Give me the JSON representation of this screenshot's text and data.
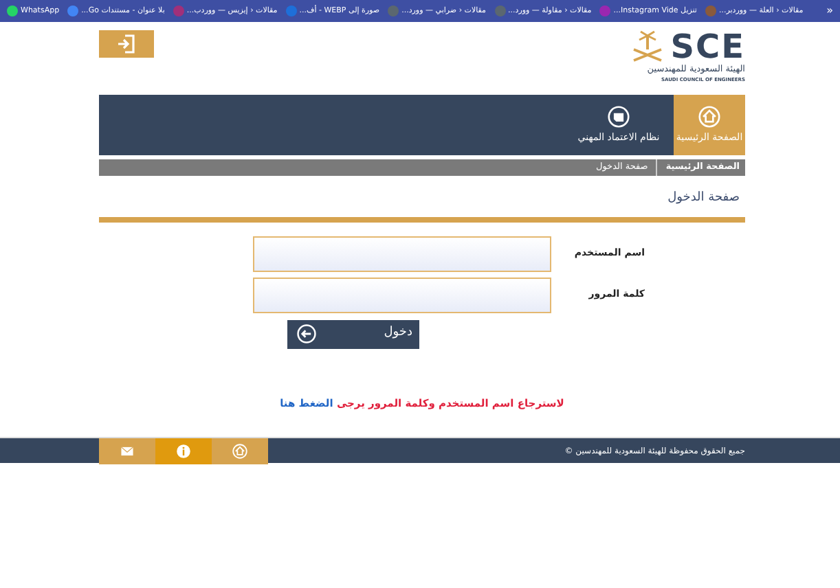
{
  "bookmarks_more": "»",
  "bookmarks": [
    {
      "label": "مقالات ‹ العلة — ووردبر...",
      "color": "#8a5a3c"
    },
    {
      "label": "تنزيل Instagram Vide...",
      "color": "#9b27b0"
    },
    {
      "label": "مقالات ‹ مقاولة — وورد...",
      "color": "#5b6770"
    },
    {
      "label": "مقالات ‹ ضرابي — وورد...",
      "color": "#5b6770"
    },
    {
      "label": "صورة إلى WEBP - أف...",
      "color": "#1e6fd9"
    },
    {
      "label": "مقالات ‹ إيزيس — ووردب...",
      "color": "#a0307a"
    },
    {
      "label": "بلا عنوان - مستندات Go...",
      "color": "#4285f4"
    },
    {
      "label": "WhatsApp",
      "color": "#25d366"
    }
  ],
  "logo": {
    "mark": "SCE",
    "name_ar": "الهيئة السعودية للمهندسين",
    "name_en": "SAUDI COUNCIL OF ENGINEERS"
  },
  "nav": [
    {
      "label": "الصفحة الرئيسية",
      "selected": true,
      "kind": "home"
    },
    {
      "label": "نظام الاعتماد المهني",
      "selected": false,
      "kind": "system"
    }
  ],
  "breadcrumb": [
    "الصفحة الرئيسية",
    "صفحة الدخول"
  ],
  "page_title": "صفحة الدخول",
  "form": {
    "fields": [
      {
        "label": "اسم المستخدم"
      },
      {
        "label": "كلمة المرور"
      }
    ],
    "submit": "دخول"
  },
  "recover": {
    "text": "لاسترجاع اسم المستخدم وكلمة المرور يرجى",
    "link": "الضغط هنا"
  },
  "footer": {
    "copyright": "جميع الحقوق محفوظة للهيئة السعودية للمهندسين ©",
    "buttons": [
      {
        "kind": "home",
        "selected": false
      },
      {
        "kind": "info",
        "selected": true
      },
      {
        "kind": "mail",
        "selected": false
      }
    ]
  }
}
